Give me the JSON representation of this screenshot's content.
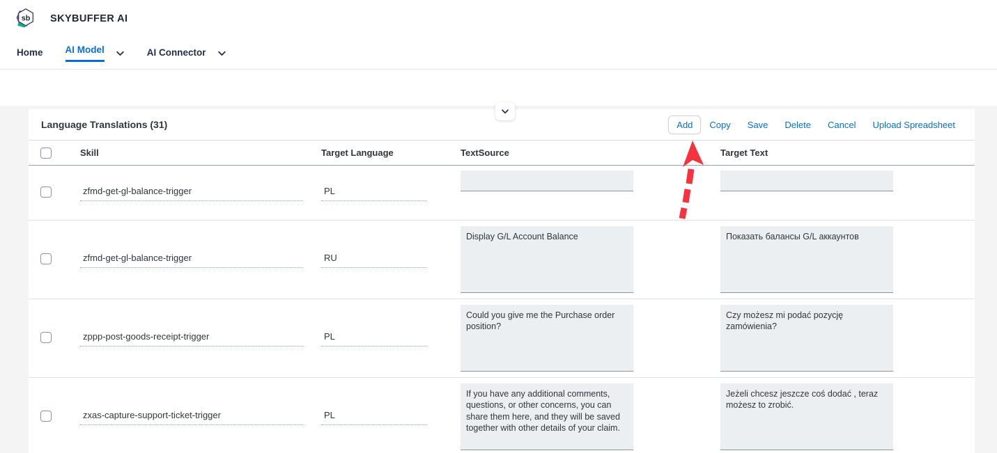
{
  "brand": {
    "logo_text": "sb",
    "logo_name": "skybuffer-logo",
    "title": "SKYBUFFER AI"
  },
  "nav": {
    "items": [
      {
        "label": "Home",
        "active": false,
        "has_caret": false
      },
      {
        "label": "AI Model",
        "active": true,
        "has_caret": true
      },
      {
        "label": "AI Connector",
        "active": false,
        "has_caret": true
      }
    ]
  },
  "collapse": {
    "icon": "chevron-down-icon"
  },
  "card": {
    "title": "Language Translations (31)",
    "actions": [
      {
        "label": "Add",
        "focused": true
      },
      {
        "label": "Copy",
        "focused": false
      },
      {
        "label": "Save",
        "focused": false
      },
      {
        "label": "Delete",
        "focused": false
      },
      {
        "label": "Cancel",
        "focused": false
      },
      {
        "label": "Upload Spreadsheet",
        "focused": false
      }
    ],
    "columns": [
      {
        "label": "Skill"
      },
      {
        "label": "Target Language"
      },
      {
        "label": "TextSource"
      },
      {
        "label": "Target Text"
      }
    ],
    "rows": [
      {
        "skill": "zfmd-get-gl-balance-trigger",
        "target_language": "PL",
        "text_source": "",
        "target_text": "",
        "clipped": true
      },
      {
        "skill": "zfmd-get-gl-balance-trigger",
        "target_language": "RU",
        "text_source": "Display G/L Account Balance",
        "target_text": "Показать балансы G/L аккаунтов",
        "clipped": false
      },
      {
        "skill": "zppp-post-goods-receipt-trigger",
        "target_language": "PL",
        "text_source": "Could you give me the Purchase order position?",
        "target_text": "Czy możesz mi podać pozycję zamówienia?",
        "clipped": false
      },
      {
        "skill": "zxas-capture-support-ticket-trigger",
        "target_language": "PL",
        "text_source": "If you have any additional comments, questions, or other concerns, you can share them here, and they will be saved together with other details of your claim.",
        "target_text": "Jeżeli chcesz jeszcze coś dodać , teraz możesz to zrobić.",
        "clipped": false
      }
    ]
  },
  "annotation": {
    "name": "red-arrow-pointing-to-add-button",
    "color": "#f5333f"
  },
  "colors": {
    "accent_blue": "#0a6ed1",
    "text_dark": "#32363a",
    "page_bg": "#f4f4f5",
    "field_bg": "#eceff1"
  }
}
